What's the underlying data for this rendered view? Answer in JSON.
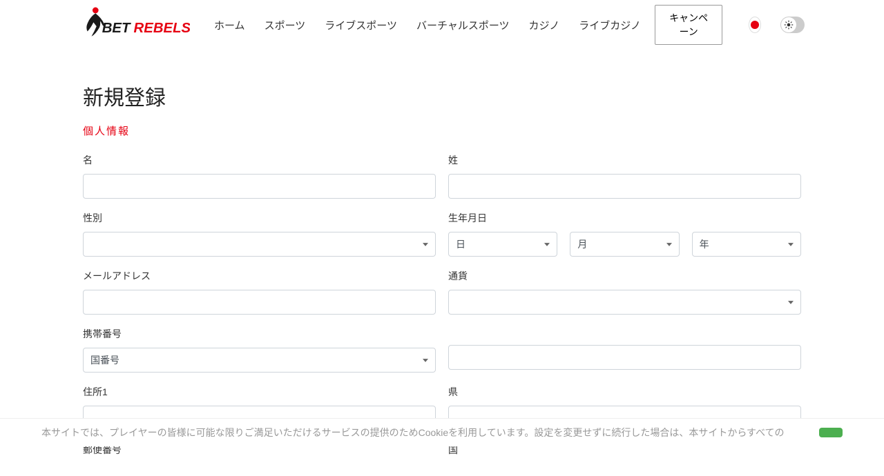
{
  "logo": {
    "text1": "BET",
    "text2": "REBELS"
  },
  "nav": {
    "items": [
      "ホーム",
      "スポーツ",
      "ライブスポーツ",
      "バーチャルスポーツ",
      "カジノ",
      "ライブカジノ"
    ],
    "campaign_button": "キャンペーン"
  },
  "page": {
    "title": "新規登録",
    "section_title": "個人情報"
  },
  "form": {
    "first_name_label": "名",
    "last_name_label": "姓",
    "gender_label": "性別",
    "dob_label": "生年月日",
    "dob_day_placeholder": "日",
    "dob_month_placeholder": "月",
    "dob_year_placeholder": "年",
    "email_label": "メールアドレス",
    "currency_label": "通貨",
    "phone_label": "携帯番号",
    "phone_code_placeholder": "国番号",
    "address_label": "住所1",
    "prefecture_label": "県",
    "postal_label": "郵便番号",
    "country_label": "国"
  },
  "cookie": {
    "text": "本サイトでは、プレイヤーの皆様に可能な限りご満足いただけるサービスの提供のためCookieを利用しています。設定を変更せずに続行した場合は、本サイトからすべての"
  },
  "colors": {
    "accent": "#e60012",
    "text": "#333333"
  }
}
